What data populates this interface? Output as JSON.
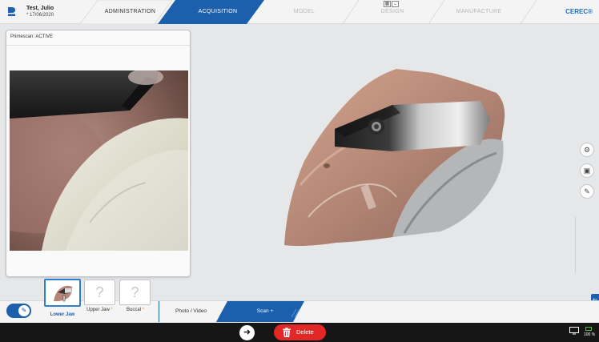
{
  "patient": {
    "name": "Test, Julio",
    "dob": "* 17/06/2020"
  },
  "workflow": {
    "steps": [
      {
        "label": "ADMINISTRATION",
        "state": "done"
      },
      {
        "label": "ACQUISITION",
        "state": "active"
      },
      {
        "label": "MODEL",
        "state": "disabled"
      },
      {
        "label": "DESIGN",
        "state": "disabled"
      },
      {
        "label": "MANUFACTURE",
        "state": "disabled"
      }
    ]
  },
  "brand": "CEREC®",
  "preview": {
    "title": "Primescan: ACTIVE"
  },
  "catalog": {
    "scans": [
      {
        "label": "Lower Jaw",
        "state": "captured"
      },
      {
        "label": "Upper Jaw",
        "state": "missing",
        "required_marker": "*",
        "placeholder": "?"
      },
      {
        "label": "Buccal",
        "state": "missing",
        "required_marker": "*",
        "placeholder": "?"
      }
    ],
    "modes": {
      "photo_video": "Photo / Video",
      "scan": "Scan +"
    }
  },
  "actions": {
    "delete_label": "Delete"
  },
  "status": {
    "battery": "100 %"
  },
  "colors": {
    "accent": "#1c5fad",
    "delete": "#e32626",
    "marker": "#e58c1a"
  },
  "icons": {
    "side_tools": [
      "settings-icon",
      "gallery-icon",
      "note-icon"
    ],
    "nav": "arrow-right-icon",
    "delete": "trash-icon"
  }
}
